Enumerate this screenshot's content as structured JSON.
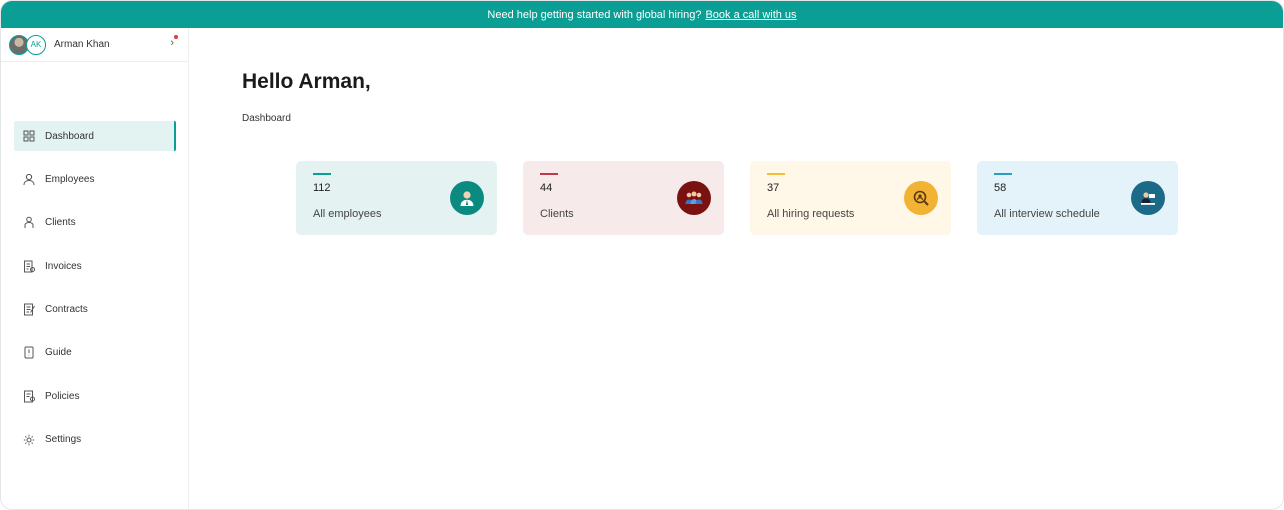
{
  "banner": {
    "text": "Need help getting started with global hiring?",
    "link": "Book a call with us"
  },
  "profile": {
    "initials": "AK",
    "name": "Arman Khan"
  },
  "nav": [
    {
      "label": "Dashboard",
      "icon": "dashboard-icon",
      "active": true
    },
    {
      "label": "Employees",
      "icon": "employees-icon"
    },
    {
      "label": "Clients",
      "icon": "clients-icon"
    },
    {
      "label": "Invoices",
      "icon": "invoices-icon"
    },
    {
      "label": "Contracts",
      "icon": "contracts-icon"
    },
    {
      "label": "Guide",
      "icon": "guide-icon"
    },
    {
      "label": "Policies",
      "icon": "policies-icon"
    },
    {
      "label": "Settings",
      "icon": "settings-icon"
    }
  ],
  "main": {
    "greeting": "Hello Arman,",
    "breadcrumb": "Dashboard"
  },
  "cards": [
    {
      "count": "112",
      "label": "All employees",
      "bg": "#e4f3f2",
      "accent": "#0b9e94",
      "badge": "#0b8a80",
      "icon": "employee-avatar-icon"
    },
    {
      "count": "44",
      "label": "Clients",
      "bg": "#f6eaeb",
      "accent": "#c0394a",
      "badge": "#7a1212",
      "icon": "clients-group-icon"
    },
    {
      "count": "37",
      "label": "All hiring requests",
      "bg": "#fff7e8",
      "accent": "#f2bf3a",
      "badge": "#f2b233",
      "icon": "hiring-search-icon"
    },
    {
      "count": "58",
      "label": "All interview schedule",
      "bg": "#e3f3f9",
      "accent": "#2a9fbd",
      "badge": "#1d6a88",
      "icon": "interview-icon"
    }
  ]
}
